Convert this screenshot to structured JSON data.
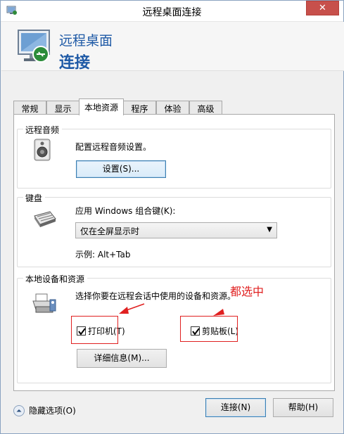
{
  "window": {
    "title": "远程桌面连接",
    "close_glyph": "✕"
  },
  "banner": {
    "line1": "远程桌面",
    "line2": "连接"
  },
  "tabs": [
    {
      "label": "常规",
      "active": false
    },
    {
      "label": "显示",
      "active": false
    },
    {
      "label": "本地资源",
      "active": true
    },
    {
      "label": "程序",
      "active": false
    },
    {
      "label": "体验",
      "active": false
    },
    {
      "label": "高级",
      "active": false
    }
  ],
  "audio": {
    "group_label": "远程音频",
    "description": "配置远程音频设置。",
    "settings_button": "设置(S)..."
  },
  "keyboard": {
    "group_label": "键盘",
    "description": "应用 Windows 组合键(K):",
    "select_value": "仅在全屏显示时",
    "example": "示例: Alt+Tab"
  },
  "devices": {
    "group_label": "本地设备和资源",
    "description": "选择你要在远程会话中使用的设备和资源。",
    "printer_label": "打印机(T)",
    "printer_checked": true,
    "clipboard_label": "剪贴板(L)",
    "clipboard_checked": true,
    "details_button": "详细信息(M)..."
  },
  "annotation": {
    "text": "都选中",
    "color": "#e02020"
  },
  "footer": {
    "hide_options": "隐藏选项(O)",
    "connect_button": "连接(N)",
    "help_button": "帮助(H)"
  },
  "colors": {
    "banner_text": "#1f5aa6",
    "close_button": "#c7504b"
  }
}
